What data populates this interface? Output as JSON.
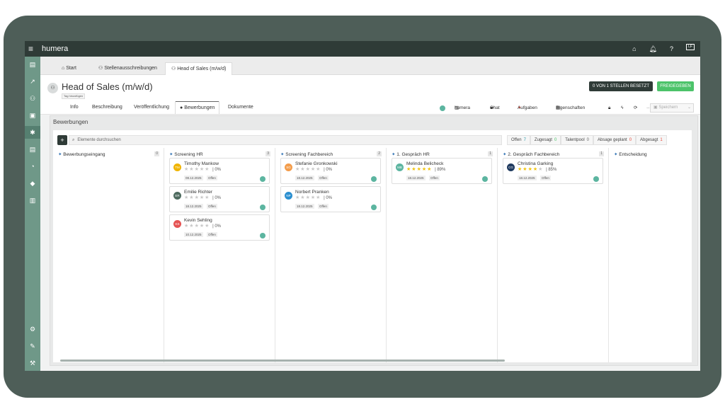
{
  "app": {
    "brand": "humera",
    "icons": [
      "home-icon",
      "bell-icon",
      "help-icon",
      "user-icon"
    ],
    "user_initials": "LF"
  },
  "nav_tabs": [
    {
      "icon": "home-icon",
      "label": "Start"
    },
    {
      "icon": "people-icon",
      "label": "Stellenausschreibungen"
    },
    {
      "icon": "people-icon",
      "label": "Head of Sales (m/w/d)"
    }
  ],
  "header": {
    "title": "Head of Sales (m/w/d)",
    "tag_label": "Tag hinzufügen",
    "stellen_button": "0 VON 1 STELLEN BESETZT",
    "release_button": "FREIGEGEBEN"
  },
  "sub_tabs": [
    "Info",
    "Beschreibung",
    "Veröffentlichung",
    "Bewerbungen",
    "Dokumente"
  ],
  "toolbar": {
    "humera": "humera",
    "chat": "Chat",
    "tasks": "Aufgaben",
    "properties": "Eigenschaften",
    "save": "Speichern"
  },
  "panel": {
    "title": "Bewerbungen",
    "search_placeholder": "Elemente durchsuchen",
    "filters": [
      {
        "label": "Offen",
        "count": "7",
        "color": "#2b9aa8"
      },
      {
        "label": "Zugesagt",
        "count": "0",
        "color": "#4cc36a"
      },
      {
        "label": "Talentpool",
        "count": "0",
        "color": "#666666"
      },
      {
        "label": "Absage geplant",
        "count": "0",
        "color": "#e74c3c"
      },
      {
        "label": "Abgesagt",
        "count": "1",
        "color": "#e74c3c"
      }
    ]
  },
  "columns": [
    {
      "title": "Bewerbungseingang",
      "count": "0",
      "cards": []
    },
    {
      "title": "Screening HR",
      "count": "3",
      "cards": [
        {
          "initials": "TM",
          "color": "#f0b400",
          "name": "Timothy Mankow",
          "stars": 0,
          "pct": "0%",
          "date": "08.12.2025",
          "status": "Offen"
        },
        {
          "initials": "ER",
          "color": "#4e6b5f",
          "name": "Emilie Richter",
          "stars": 0,
          "pct": "0%",
          "date": "18.12.2025",
          "status": "Offen"
        },
        {
          "initials": "KS",
          "color": "#e55353",
          "name": "Kevin Sehling",
          "stars": 0,
          "pct": "0%",
          "date": "10.12.2025",
          "status": "Offen"
        }
      ]
    },
    {
      "title": "Screening Fachbereich",
      "count": "2",
      "cards": [
        {
          "initials": "SG",
          "color": "#f39c4a",
          "name": "Stefanie Gronkowski",
          "stars": 0,
          "pct": "0%",
          "date": "18.12.2025",
          "status": "Offen"
        },
        {
          "initials": "NP",
          "color": "#2b8fd0",
          "name": "Norbert Pranken",
          "stars": 0,
          "pct": "0%",
          "date": "18.12.2025",
          "status": "Offen"
        }
      ]
    },
    {
      "title": "1. Gespräch HR",
      "count": "1",
      "cards": [
        {
          "initials": "MB",
          "color": "#5cb5a0",
          "name": "Melinda Belicheck",
          "stars": 5,
          "pct": "89%",
          "date": "18.12.2025",
          "status": "Offen"
        }
      ]
    },
    {
      "title": "2. Gespräch Fachbereich",
      "count": "1",
      "cards": [
        {
          "initials": "CG",
          "color": "#1f3a5f",
          "name": "Christina Garking",
          "stars": 4,
          "pct": "85%",
          "date": "18.12.2025",
          "status": "Offen"
        }
      ]
    },
    {
      "title": "Entscheidung",
      "count": "",
      "cards": []
    }
  ]
}
